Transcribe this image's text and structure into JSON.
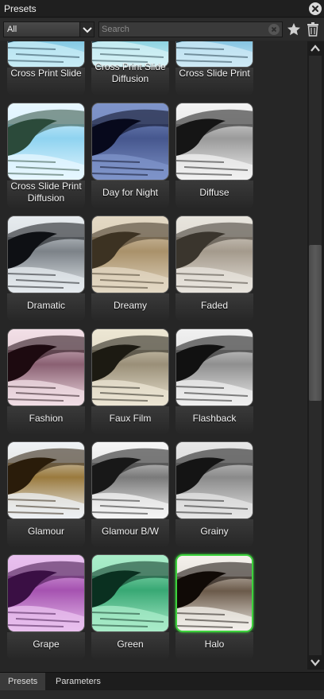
{
  "window": {
    "title": "Presets"
  },
  "toolbar": {
    "filter_value": "All",
    "search_placeholder": "Search"
  },
  "presets": [
    {
      "label": "Cross Print Slide",
      "tint": "#5ab4d8",
      "dark": "#1f3a4a",
      "light": "#c8ecf6"
    },
    {
      "label": "Cross Print Slide Diffusion",
      "tint": "#63c2d6",
      "dark": "#27424c",
      "light": "#d6f2f6"
    },
    {
      "label": "Cross Slide Print",
      "tint": "#5bb0d8",
      "dark": "#203a48",
      "light": "#cfeaf5"
    },
    {
      "label": "Cross Slide Print Diffusion",
      "tint": "#8fd3f0",
      "dark": "#2b4a3a",
      "light": "#e7f7ff"
    },
    {
      "label": "Day for Night",
      "tint": "#46578e",
      "dark": "#07091c",
      "light": "#7f94c9"
    },
    {
      "label": "Diffuse",
      "tint": "#9a9a9a",
      "dark": "#151515",
      "light": "#f2f2f2"
    },
    {
      "label": "Dramatic",
      "tint": "#7c8288",
      "dark": "#0e1014",
      "light": "#e6ebef"
    },
    {
      "label": "Dreamy",
      "tint": "#a9916a",
      "dark": "#3c3222",
      "light": "#e3d8c4"
    },
    {
      "label": "Faded",
      "tint": "#a49a8c",
      "dark": "#3a352d",
      "light": "#e8e4dd"
    },
    {
      "label": "Fashion",
      "tint": "#8a6072",
      "dark": "#1d0a10",
      "light": "#f2dfe6"
    },
    {
      "label": "Faux Film",
      "tint": "#9a8f78",
      "dark": "#1c1a12",
      "light": "#ece6d4"
    },
    {
      "label": "Flashback",
      "tint": "#8f8f8f",
      "dark": "#111111",
      "light": "#f0f0f0"
    },
    {
      "label": "Glamour",
      "tint": "#9a7a3e",
      "dark": "#2a1c0a",
      "light": "#eef2f6"
    },
    {
      "label": "Glamour B/W",
      "tint": "#7a7a7a",
      "dark": "#181818",
      "light": "#f6f6f6"
    },
    {
      "label": "Grainy",
      "tint": "#8a8a8a",
      "dark": "#141414",
      "light": "#e6e6e6"
    },
    {
      "label": "Grape",
      "tint": "#a552b0",
      "dark": "#3a0f44",
      "light": "#e9c1ef"
    },
    {
      "label": "Green",
      "tint": "#38a874",
      "dark": "#0a3020",
      "light": "#a9ecc9"
    },
    {
      "label": "Halo",
      "tint": "#6b5a4a",
      "dark": "#100a06",
      "light": "#f4f1ec"
    }
  ],
  "selected_preset": "Halo",
  "selection_color": "#3dd13d",
  "tabs": [
    {
      "label": "Presets"
    },
    {
      "label": "Parameters"
    }
  ],
  "icons": {
    "close": "close-icon",
    "dropdown": "chevron-down-icon",
    "clear": "clear-search-icon",
    "favorite": "star-icon",
    "delete": "trash-icon",
    "scroll_up": "scroll-up-icon",
    "scroll_down": "scroll-down-icon"
  }
}
